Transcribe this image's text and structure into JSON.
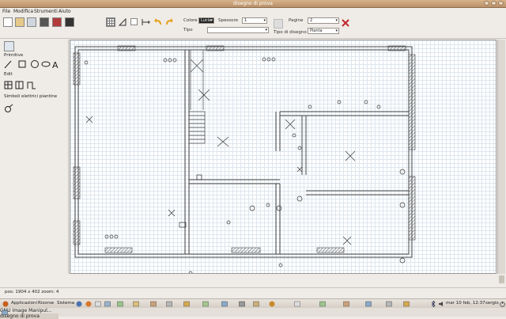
{
  "window": {
    "title": "disegno di prova"
  },
  "menu": [
    "File",
    "Modifica",
    "Strumenti",
    "Aiuto"
  ],
  "toolbar": {
    "colore_label": "Colore",
    "colore_value": "Lucia",
    "spessore_label": "Spessore",
    "spessore_value": "1",
    "tipo_label": "Tipo",
    "tipo_value": "",
    "pagine_label": "Pagine",
    "pagine_value": "2",
    "tipo_disegno_label": "Tipo di disegno",
    "tipo_disegno_value": "Pianta"
  },
  "left_panel": {
    "primitive_label": "Primitive",
    "edit_label": "Edit",
    "symbols_label": "Simboli elettrici piantine"
  },
  "status": {
    "text": "pos: 1904 x 402  zoom: 4"
  },
  "taskbar": {
    "applicazioni": "Applicazioni",
    "risorse": "Risorse",
    "sistema": "Sistema",
    "task1": "GNU Image Manipul...",
    "task2": "disegno di prova",
    "clock": "mar 10 feb, 12:37",
    "user": "sergio"
  }
}
